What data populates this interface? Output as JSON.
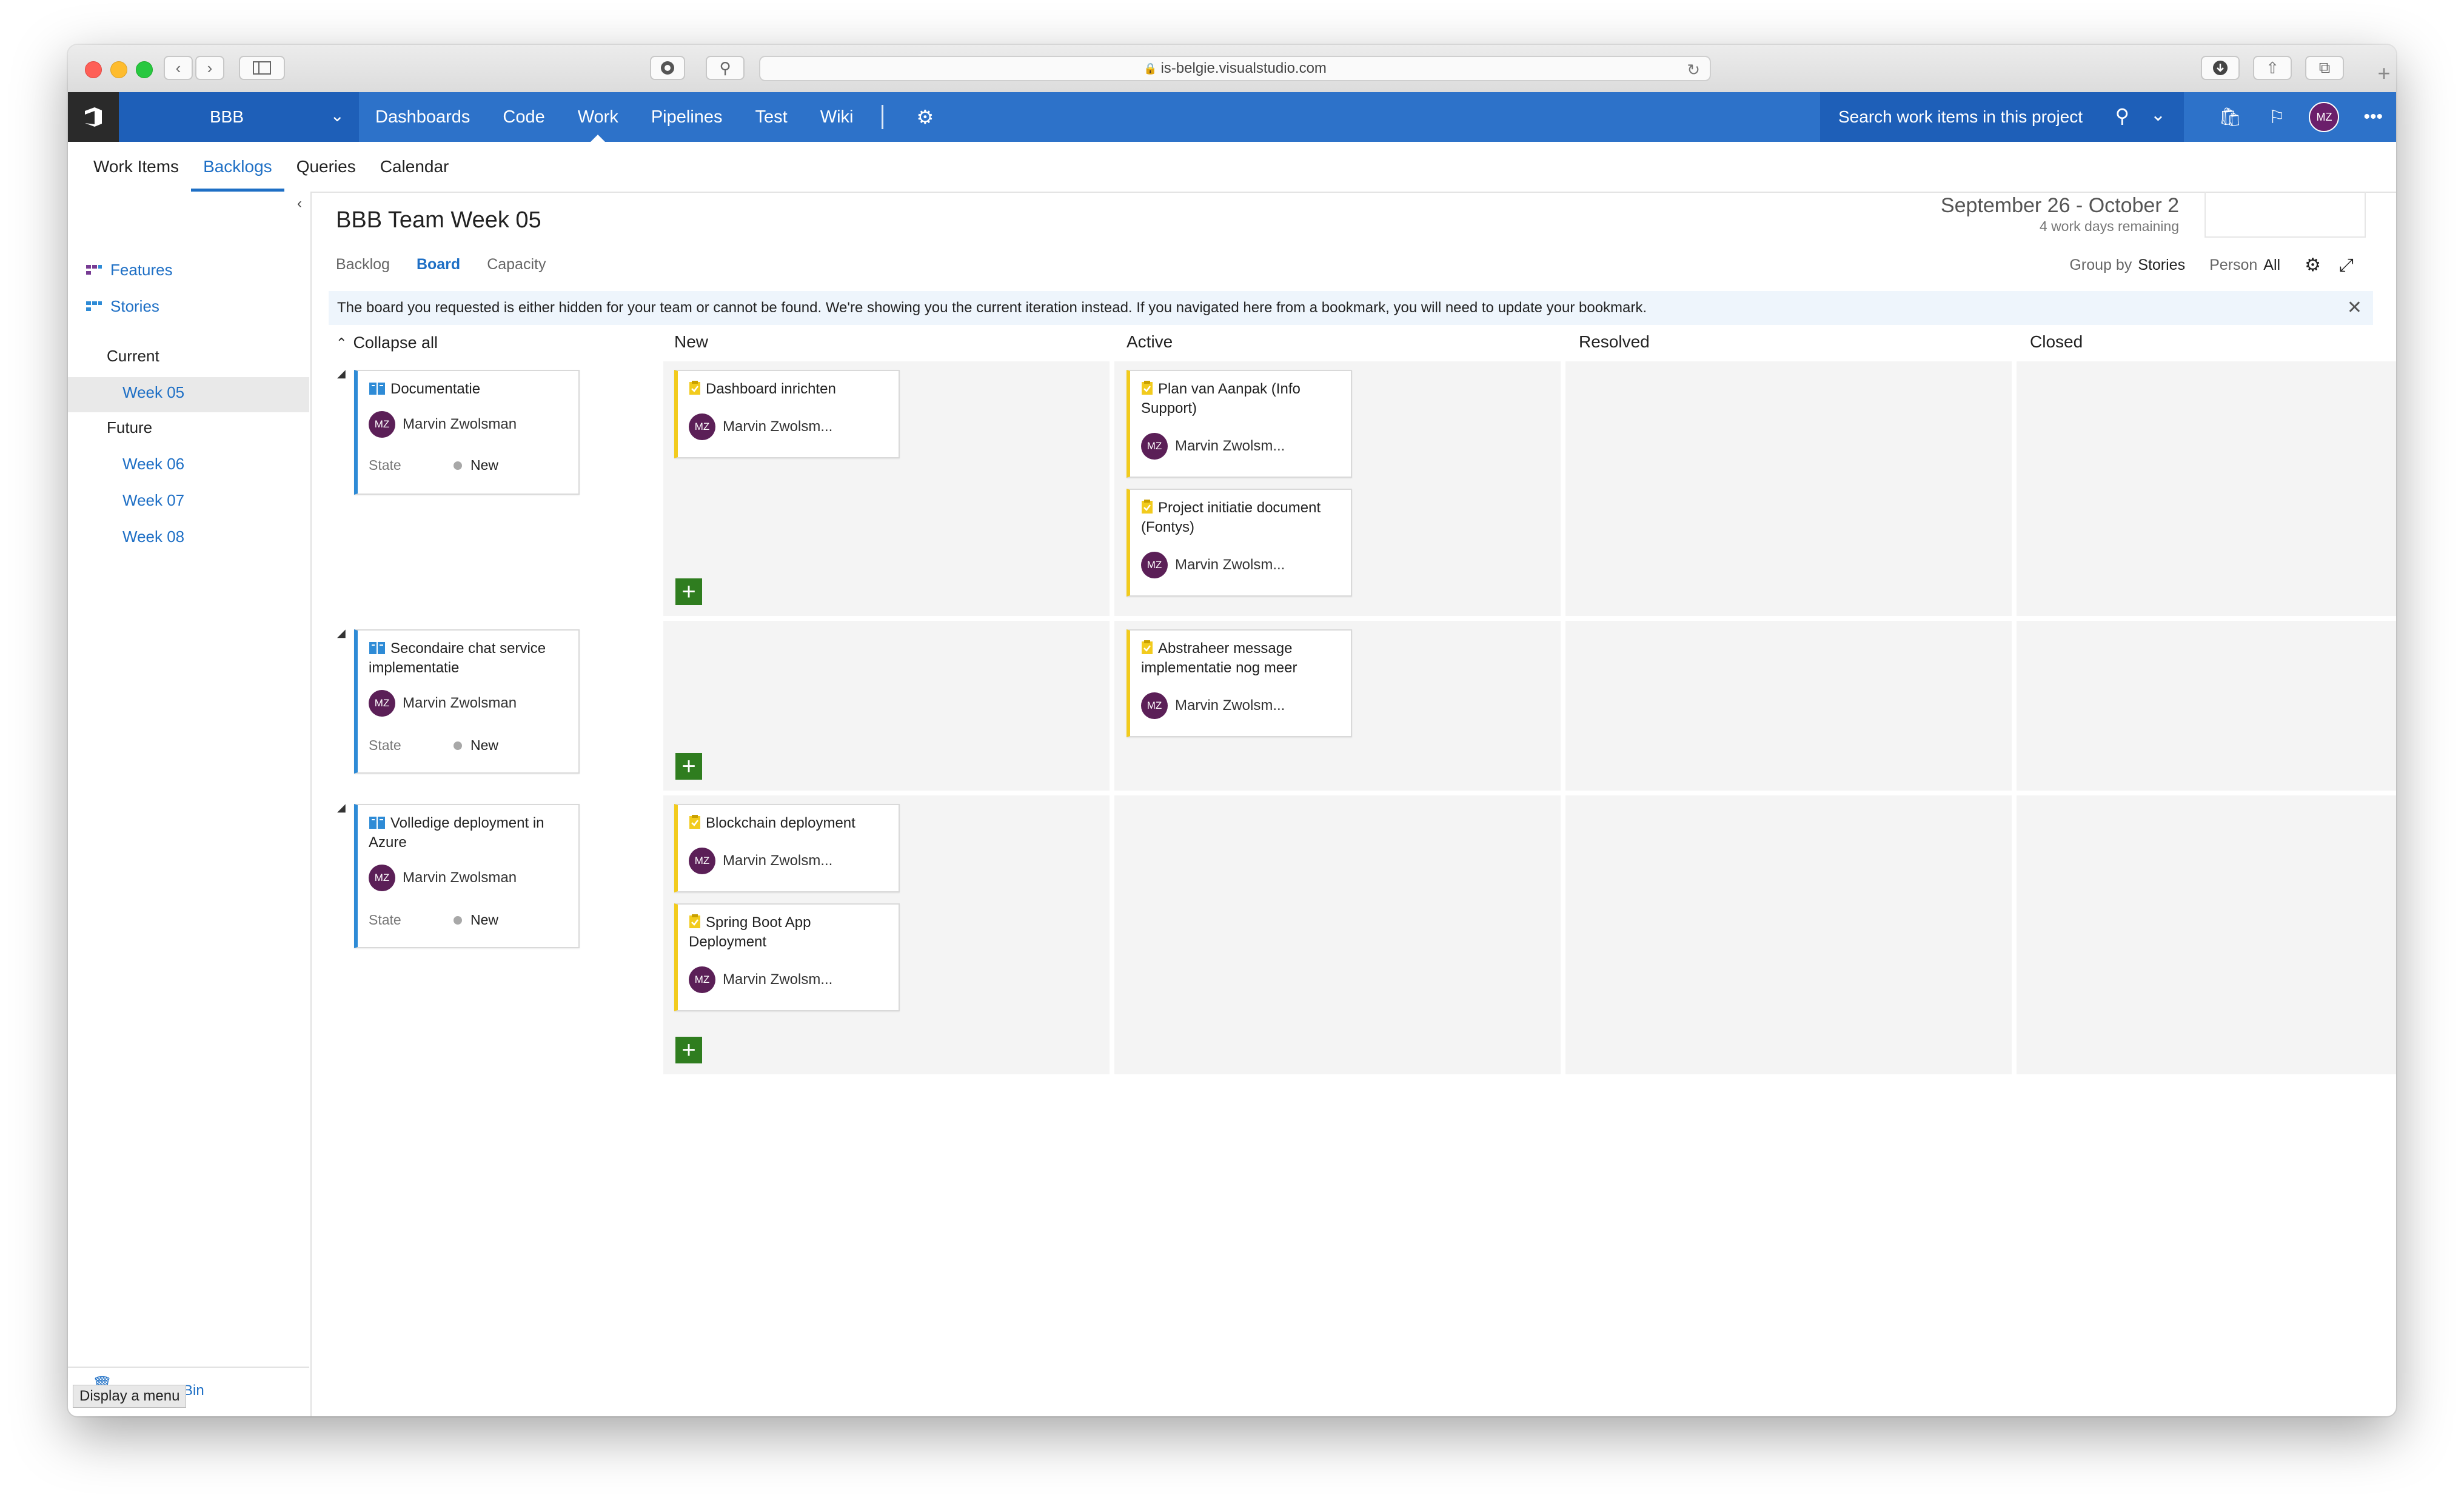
{
  "browser": {
    "url": "is-belgie.visualstudio.com"
  },
  "topnav": {
    "project": "BBB",
    "links": [
      "Dashboards",
      "Code",
      "Work",
      "Pipelines",
      "Test",
      "Wiki"
    ],
    "active": "Work",
    "search_placeholder": "Search work items in this project",
    "user_initials": "MZ"
  },
  "subnav": {
    "tabs": [
      "Work Items",
      "Backlogs",
      "Queries",
      "Calendar"
    ],
    "active": "Backlogs"
  },
  "sidebar": {
    "backlogs": [
      "Features",
      "Stories"
    ],
    "current_label": "Current",
    "current_week": "Week 05",
    "future_label": "Future",
    "future_weeks": [
      "Week 06",
      "Week 07",
      "Week 08"
    ],
    "bin_text": "Bin",
    "tooltip": "Display a menu"
  },
  "header": {
    "title": "BBB Team Week 05",
    "date_range": "September 26 - October 2",
    "work_days": "4 work days remaining",
    "view_tabs": [
      "Backlog",
      "Board",
      "Capacity"
    ],
    "active_view": "Board",
    "group_by_label": "Group by",
    "group_by_value": "Stories",
    "person_label": "Person",
    "person_value": "All"
  },
  "banner": {
    "message": "The board you requested is either hidden for your team or cannot be found. We're showing you the current iteration instead. If you navigated here from a bookmark, you will need to update your bookmark."
  },
  "board": {
    "collapse_all": "Collapse all",
    "columns": [
      "New",
      "Active",
      "Resolved",
      "Closed"
    ],
    "state_label": "State",
    "lanes": [
      {
        "story": {
          "title": "Documentatie",
          "assignee": "Marvin Zwolsman",
          "initials": "MZ",
          "state": "New"
        },
        "new": [
          {
            "title": "Dashboard inrichten",
            "assignee": "Marvin Zwolsm...",
            "initials": "MZ"
          }
        ],
        "active": [
          {
            "title": "Plan van Aanpak (Info Support)",
            "assignee": "Marvin Zwolsm...",
            "initials": "MZ"
          },
          {
            "title": "Project initiatie document (Fontys)",
            "assignee": "Marvin Zwolsm...",
            "initials": "MZ"
          }
        ]
      },
      {
        "story": {
          "title": "Secondaire chat service implementatie",
          "assignee": "Marvin Zwolsman",
          "initials": "MZ",
          "state": "New"
        },
        "new": [],
        "active": [
          {
            "title": "Abstraheer message implementatie nog meer",
            "assignee": "Marvin Zwolsm...",
            "initials": "MZ"
          }
        ]
      },
      {
        "story": {
          "title": "Volledige deployment in Azure",
          "assignee": "Marvin Zwolsman",
          "initials": "MZ",
          "state": "New"
        },
        "new": [
          {
            "title": "Blockchain deployment",
            "assignee": "Marvin Zwolsm...",
            "initials": "MZ"
          },
          {
            "title": "Spring Boot App Deployment",
            "assignee": "Marvin Zwolsm...",
            "initials": "MZ"
          }
        ],
        "active": []
      }
    ]
  },
  "colors": {
    "nav_blue": "#2d72c9",
    "nav_dark_blue": "#1e5fb8",
    "story_blue": "#2e8bd6",
    "task_yellow": "#f2cb1d",
    "add_green": "#2f7d1f",
    "avatar_purple": "#5b1f57"
  }
}
